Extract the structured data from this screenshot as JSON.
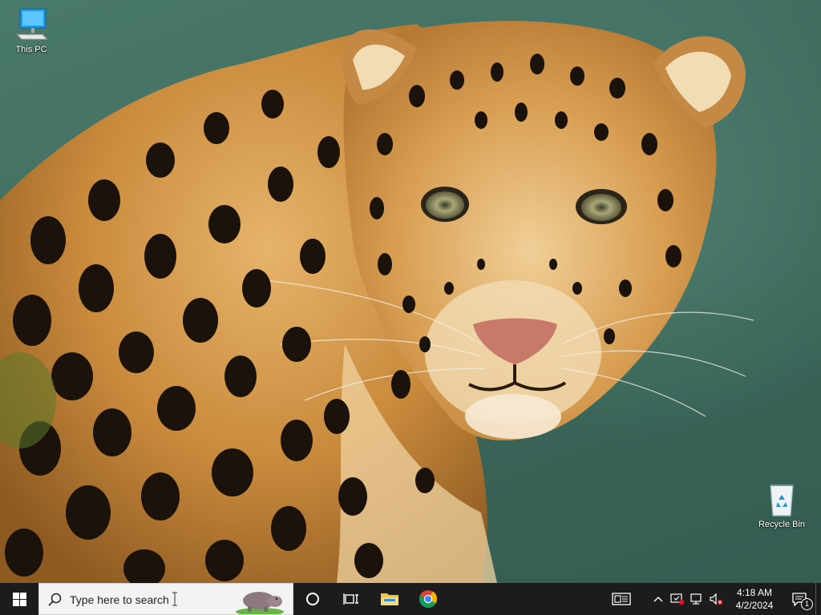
{
  "desktop": {
    "icons": [
      {
        "label": "This PC"
      },
      {
        "label": "Recycle Bin"
      }
    ]
  },
  "taskbar": {
    "search": {
      "placeholder": "Type here to search"
    },
    "pinned": [
      "task-view",
      "file-explorer",
      "chrome"
    ],
    "clock": {
      "time": "4:18 AM",
      "date": "4/2/2024"
    },
    "notifications": {
      "count": "1"
    }
  },
  "colors": {
    "taskbar_bg": "#1c1c1c",
    "wallpaper_bg": "#3f6a5f",
    "accent": "#0078d7"
  }
}
